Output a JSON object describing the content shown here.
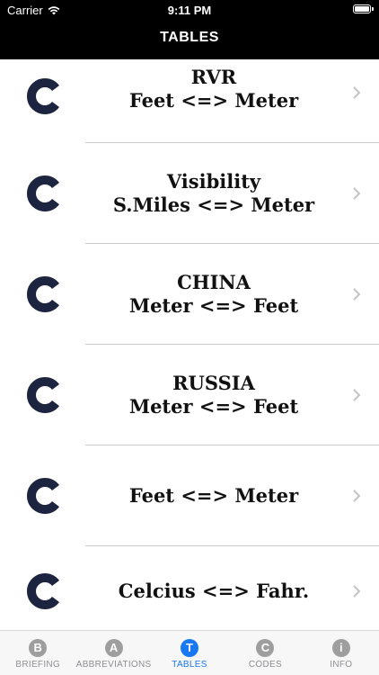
{
  "status_bar": {
    "carrier": "Carrier",
    "time": "9:11 PM"
  },
  "nav": {
    "title": "TABLES"
  },
  "rows": [
    {
      "line1": "RVR",
      "line2": "Feet <=> Meter"
    },
    {
      "line1": "Visibility",
      "line2": "S.Miles <=> Meter"
    },
    {
      "line1": "CHINA",
      "line2": "Meter <=> Feet"
    },
    {
      "line1": "RUSSIA",
      "line2": "Meter <=> Feet"
    },
    {
      "line1": "Feet <=> Meter"
    },
    {
      "line1": "Celcius <=> Fahr."
    }
  ],
  "tabs": [
    {
      "icon": "B",
      "label": "BRIEFING"
    },
    {
      "icon": "A",
      "label": "ABBREVIATIONS"
    },
    {
      "icon": "T",
      "label": "TABLES"
    },
    {
      "icon": "C",
      "label": "CODES"
    },
    {
      "icon": "i",
      "label": "INFO"
    }
  ],
  "colors": {
    "logo": "#1c2440",
    "active_tab": "#1877f2",
    "header": "#000000"
  }
}
